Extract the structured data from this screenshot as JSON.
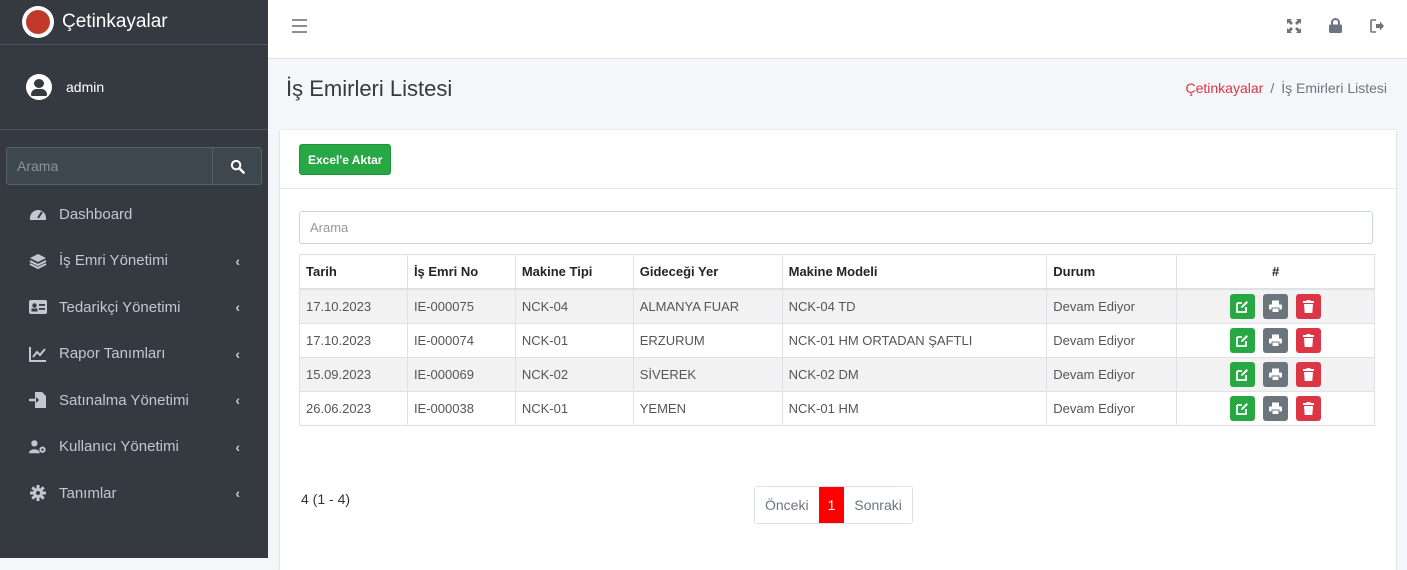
{
  "brand": {
    "name": "Çetinkayalar"
  },
  "user": {
    "name": "admin"
  },
  "sidebar": {
    "search_placeholder": "Arama",
    "items": [
      {
        "label": "Dashboard",
        "icon": "dashboard-icon",
        "has_children": false
      },
      {
        "label": "İş Emri Yönetimi",
        "icon": "layers-icon",
        "has_children": true
      },
      {
        "label": "Tedarikçi Yönetimi",
        "icon": "id-card-icon",
        "has_children": true
      },
      {
        "label": "Rapor Tanımları",
        "icon": "chart-line-icon",
        "has_children": true
      },
      {
        "label": "Satınalma Yönetimi",
        "icon": "file-import-icon",
        "has_children": true
      },
      {
        "label": "Kullanıcı Yönetimi",
        "icon": "user-cog-icon",
        "has_children": true
      },
      {
        "label": "Tanımlar",
        "icon": "cog-icon",
        "has_children": true
      }
    ]
  },
  "topbar": {
    "icons": [
      "menu-icon",
      "fullscreen-icon",
      "lock-icon",
      "logout-icon"
    ]
  },
  "page": {
    "title": "İş Emirleri Listesi",
    "breadcrumb": {
      "home": "Çetinkayalar",
      "separator": "/",
      "current": "İş Emirleri Listesi"
    }
  },
  "card": {
    "export_label": "Excel'e Aktar",
    "search_placeholder": "Arama",
    "columns": [
      "Tarih",
      "İş Emri No",
      "Makine Tipi",
      "Gideceği Yer",
      "Makine Modeli",
      "Durum",
      "#"
    ],
    "rows": [
      {
        "tarih": "17.10.2023",
        "no": "IE-000075",
        "tip": "NCK-04",
        "yer": "ALMANYA FUAR",
        "model": "NCK-04 TD",
        "durum": "Devam Ediyor"
      },
      {
        "tarih": "17.10.2023",
        "no": "IE-000074",
        "tip": "NCK-01",
        "yer": "ERZURUM",
        "model": "NCK-01 HM ORTADAN ŞAFTLI",
        "durum": "Devam Ediyor"
      },
      {
        "tarih": "15.09.2023",
        "no": "IE-000069",
        "tip": "NCK-02",
        "yer": "SİVEREK",
        "model": "NCK-02 DM",
        "durum": "Devam Ediyor"
      },
      {
        "tarih": "26.06.2023",
        "no": "IE-000038",
        "tip": "NCK-01",
        "yer": "YEMEN",
        "model": "NCK-01 HM",
        "durum": "Devam Ediyor"
      }
    ],
    "info": "4 (1 - 4)",
    "pager": {
      "prev": "Önceki",
      "current": "1",
      "next": "Sonraki"
    }
  },
  "colors": {
    "sidebar_bg": "#343a40",
    "accent_red": "#dc3545",
    "success": "#28a745",
    "page_active": "#ff0000"
  }
}
